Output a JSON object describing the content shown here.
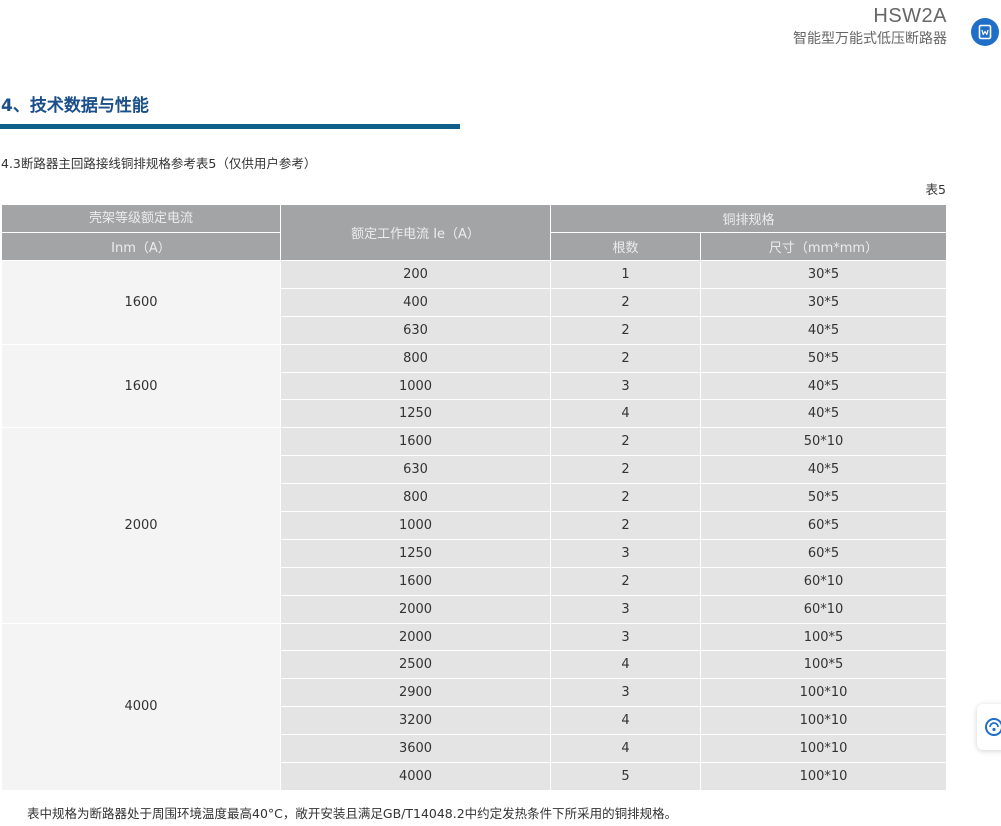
{
  "header": {
    "model": "HSW2A",
    "product_name": "智能型万能式低压断路器"
  },
  "section": {
    "title": "4、技术数据与性能",
    "subtitle": "4.3断路器主回路接线铜排规格参考表5（仅供用户参考）",
    "table_label": "表5"
  },
  "table": {
    "headers": {
      "frame_current_line1": "壳架等级额定电流",
      "frame_current_line2": "Inm（A）",
      "rated_current": "额定工作电流 Ie（A）",
      "busbar_spec": "铜排规格",
      "count": "根数",
      "size": "尺寸（mm*mm）"
    },
    "groups": [
      {
        "frame": "1600",
        "rows": [
          {
            "ie": "200",
            "count": "1",
            "size": "30*5"
          },
          {
            "ie": "400",
            "count": "2",
            "size": "30*5"
          },
          {
            "ie": "630",
            "count": "2",
            "size": "40*5"
          }
        ]
      },
      {
        "frame": "1600",
        "rows": [
          {
            "ie": "800",
            "count": "2",
            "size": "50*5"
          },
          {
            "ie": "1000",
            "count": "3",
            "size": "40*5"
          },
          {
            "ie": "1250",
            "count": "4",
            "size": "40*5"
          }
        ]
      },
      {
        "frame": "2000",
        "rows": [
          {
            "ie": "1600",
            "count": "2",
            "size": "50*10"
          },
          {
            "ie": "630",
            "count": "2",
            "size": "40*5"
          },
          {
            "ie": "800",
            "count": "2",
            "size": "50*5"
          },
          {
            "ie": "1000",
            "count": "2",
            "size": "60*5"
          },
          {
            "ie": "1250",
            "count": "3",
            "size": "60*5"
          },
          {
            "ie": "1600",
            "count": "2",
            "size": "60*10"
          },
          {
            "ie": "2000",
            "count": "3",
            "size": "60*10"
          }
        ]
      },
      {
        "frame": "4000",
        "rows": [
          {
            "ie": "2000",
            "count": "3",
            "size": "100*5"
          },
          {
            "ie": "2500",
            "count": "4",
            "size": "100*5"
          },
          {
            "ie": "2900",
            "count": "3",
            "size": "100*10"
          },
          {
            "ie": "3200",
            "count": "4",
            "size": "100*10"
          },
          {
            "ie": "3600",
            "count": "4",
            "size": "100*10"
          },
          {
            "ie": "4000",
            "count": "5",
            "size": "100*10"
          }
        ]
      }
    ]
  },
  "footnote": "表中规格为断路器处于周围环境温度最高40°C，敞开安装且满足GB/T14048.2中约定发热条件下所采用的铜排规格。",
  "colors": {
    "title_blue": "#1a4f8a",
    "rule_blue": "#0f5f8b",
    "header_gray": "#a3a4a6",
    "cell_gray": "#e4e4e4",
    "frame_cell": "#f4f4f4",
    "icon_blue": "#1f6fc8"
  },
  "icons": {
    "document_button": "document-icon",
    "side_float": "customer-service-icon"
  }
}
